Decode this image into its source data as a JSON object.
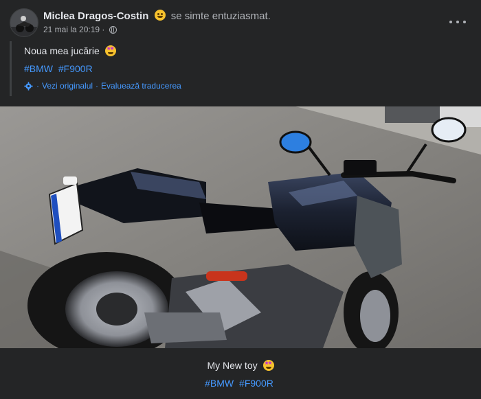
{
  "post": {
    "author": "Miclea Dragos-Costin",
    "feeling": "se simte entuziasmat.",
    "timestamp": "21 mai la 20:19",
    "separator": "·",
    "privacy_icon": "globe-icon",
    "more_icon": "more-horizontal-icon"
  },
  "quote": {
    "text": "Noua mea jucărie",
    "hashtags": [
      "#BMW",
      "#F900R"
    ],
    "view_original": "Vezi originalul",
    "rate_translation": "Evaluează traducerea",
    "dot": "·"
  },
  "photo": {
    "subject": "motorcycle-photo",
    "colors": {
      "asphalt": "#8d8b88",
      "bike": "#1b2130",
      "accent_red": "#c8341c",
      "mirror_blue": "#2d7fe0"
    }
  },
  "caption": {
    "text": "My New toy",
    "hashtags": [
      "#BMW",
      "#F900R"
    ]
  },
  "colors": {
    "background": "#242526",
    "text": "#e4e6eb",
    "secondary_text": "#b0b3b8",
    "link": "#4599ff"
  }
}
